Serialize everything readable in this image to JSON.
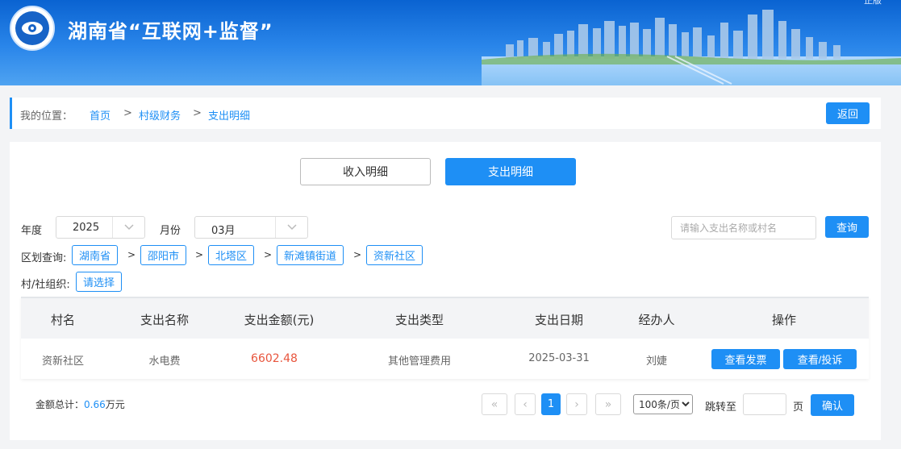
{
  "header": {
    "title": "湖南省“互联网+监督”",
    "corner_text": "正版",
    "logo_icon": "eye-seal-icon"
  },
  "breadcrumb": {
    "label": "我的位置：",
    "items": [
      "首页",
      "村级财务",
      "支出明细"
    ],
    "separator": ">",
    "back_label": "返回"
  },
  "tabs": [
    {
      "label": "收入明细",
      "active": false
    },
    {
      "label": "支出明细",
      "active": true
    }
  ],
  "filters": {
    "year_label": "年度",
    "year_value": "2025",
    "month_label": "月份",
    "month_value": "03月",
    "search_placeholder": "请输入支出名称或村名",
    "search_button": "查询",
    "region_label": "区划查询:",
    "regions": [
      "湖南省",
      "邵阳市",
      "北塔区",
      "新滩镇街道",
      "资新社区"
    ],
    "region_sep": ">",
    "org_label": "村/社组织:",
    "org_value": "请选择"
  },
  "table": {
    "headers": [
      "村名",
      "支出名称",
      "支出金额(元)",
      "支出类型",
      "支出日期",
      "经办人",
      "操作"
    ],
    "rows": [
      {
        "village": "资新社区",
        "name": "水电费",
        "amount": "6602.48",
        "type": "其他管理费用",
        "date": "2025-03-31",
        "handler": "刘婕",
        "actions": [
          "查看发票",
          "查看/投诉"
        ]
      }
    ]
  },
  "footer": {
    "total_label": "金额总计：",
    "total_value": "0.66",
    "total_unit": "万元",
    "pager": {
      "first": "«",
      "prev": "‹",
      "current": "1",
      "next": "›",
      "last": "»"
    },
    "page_size": "100条/页",
    "jump_label": "跳转至",
    "page_unit": "页",
    "confirm_label": "确认"
  },
  "colors": {
    "primary": "#1e8ff5",
    "amount": "#e8553d",
    "header_bg": "#0a63d1"
  }
}
